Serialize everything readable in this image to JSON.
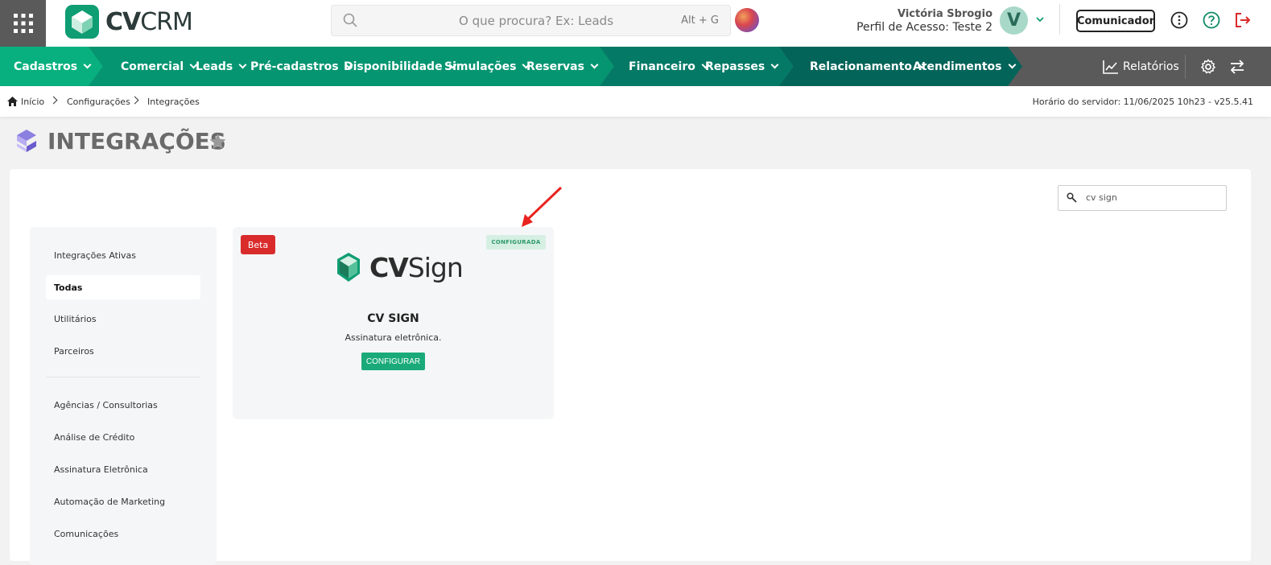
{
  "header": {
    "logo_bold": "CV",
    "logo_light": "CRM",
    "search_placeholder": "O que procura? Ex: Leads",
    "search_shortcut": "Alt + G",
    "user_name": "Victória Sbrogio",
    "user_profile": "Perfil de Acesso: Teste 2",
    "avatar_initial": "V",
    "communicator_label": "Comunicador"
  },
  "nav": {
    "items": [
      {
        "label": "Cadastros"
      },
      {
        "label": "Comercial"
      },
      {
        "label": "Leads"
      },
      {
        "label": "Pré-cadastros"
      },
      {
        "label": "Disponibilidade"
      },
      {
        "label": "Simulações"
      },
      {
        "label": "Reservas"
      },
      {
        "label": "Financeiro"
      },
      {
        "label": "Repasses"
      },
      {
        "label": "Relacionamento"
      },
      {
        "label": "Atendimentos"
      }
    ],
    "reports_label": "Relatórios",
    "colors": {
      "teal1": "#07b07e",
      "teal2": "#059571",
      "teal3": "#047a66",
      "teal4": "#036459",
      "gray": "#5a5a5a"
    }
  },
  "breadcrumb": {
    "items": [
      "Início",
      "Configurações",
      "Integrações"
    ],
    "server_time": "Horário do servidor: 11/06/2025 10h23 - v25.5.41"
  },
  "page": {
    "title": "INTEGRAÇÕES"
  },
  "filter": {
    "value": "cv sign"
  },
  "sidebar": {
    "items": [
      {
        "label": "Integrações Ativas"
      },
      {
        "label": "Todas"
      },
      {
        "label": "Utilitários"
      },
      {
        "label": "Parceiros"
      },
      {
        "label": "Agências / Consultorias"
      },
      {
        "label": "Análise de Crédito"
      },
      {
        "label": "Assinatura Eletrônica"
      },
      {
        "label": "Automação de Marketing"
      },
      {
        "label": "Comunicações"
      }
    ]
  },
  "card": {
    "beta_label": "Beta",
    "status_label": "CONFIGURADA",
    "logo_bold": "CV",
    "logo_light": "Sign",
    "title": "CV SIGN",
    "description": "Assinatura eletrônica.",
    "button_label": "CONFIGURAR"
  }
}
